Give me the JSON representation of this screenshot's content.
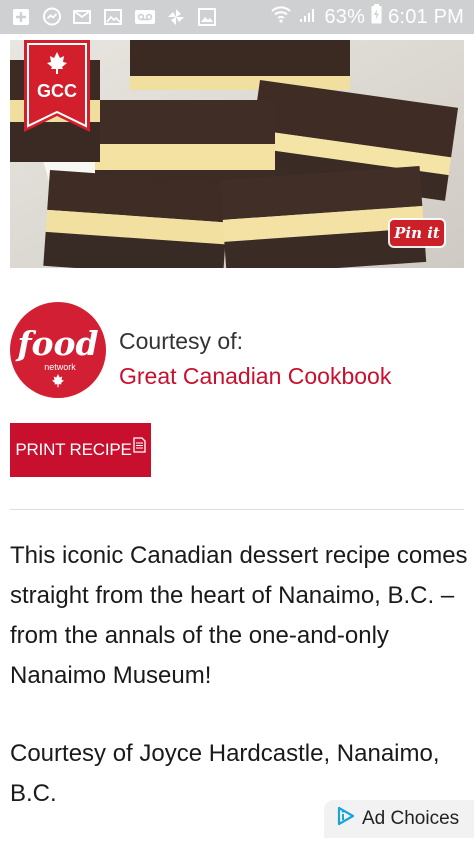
{
  "status_bar": {
    "battery": "63%",
    "time": "6:01 PM"
  },
  "hero": {
    "badge_text": "GCC",
    "pin_label": "Pin it"
  },
  "courtesy": {
    "logo_text": "food",
    "logo_subtext": "network",
    "label": "Courtesy of:",
    "source": "Great Canadian Cookbook"
  },
  "print_button": {
    "label": "PRINT RECIPE"
  },
  "description": {
    "paragraph1": "This iconic Canadian dessert recipe comes straight from the heart of Nanaimo, B.C. – from the annals of the one-and-only Nanaimo Museum!",
    "paragraph2": "Courtesy of Joyce Hardcastle, Nanaimo, B.C."
  },
  "ad": {
    "label": "Ad Choices"
  },
  "colors": {
    "accent_red": "#c8102e",
    "status_bar": "#cfd0d2",
    "pinterest_red": "#cb2027"
  }
}
